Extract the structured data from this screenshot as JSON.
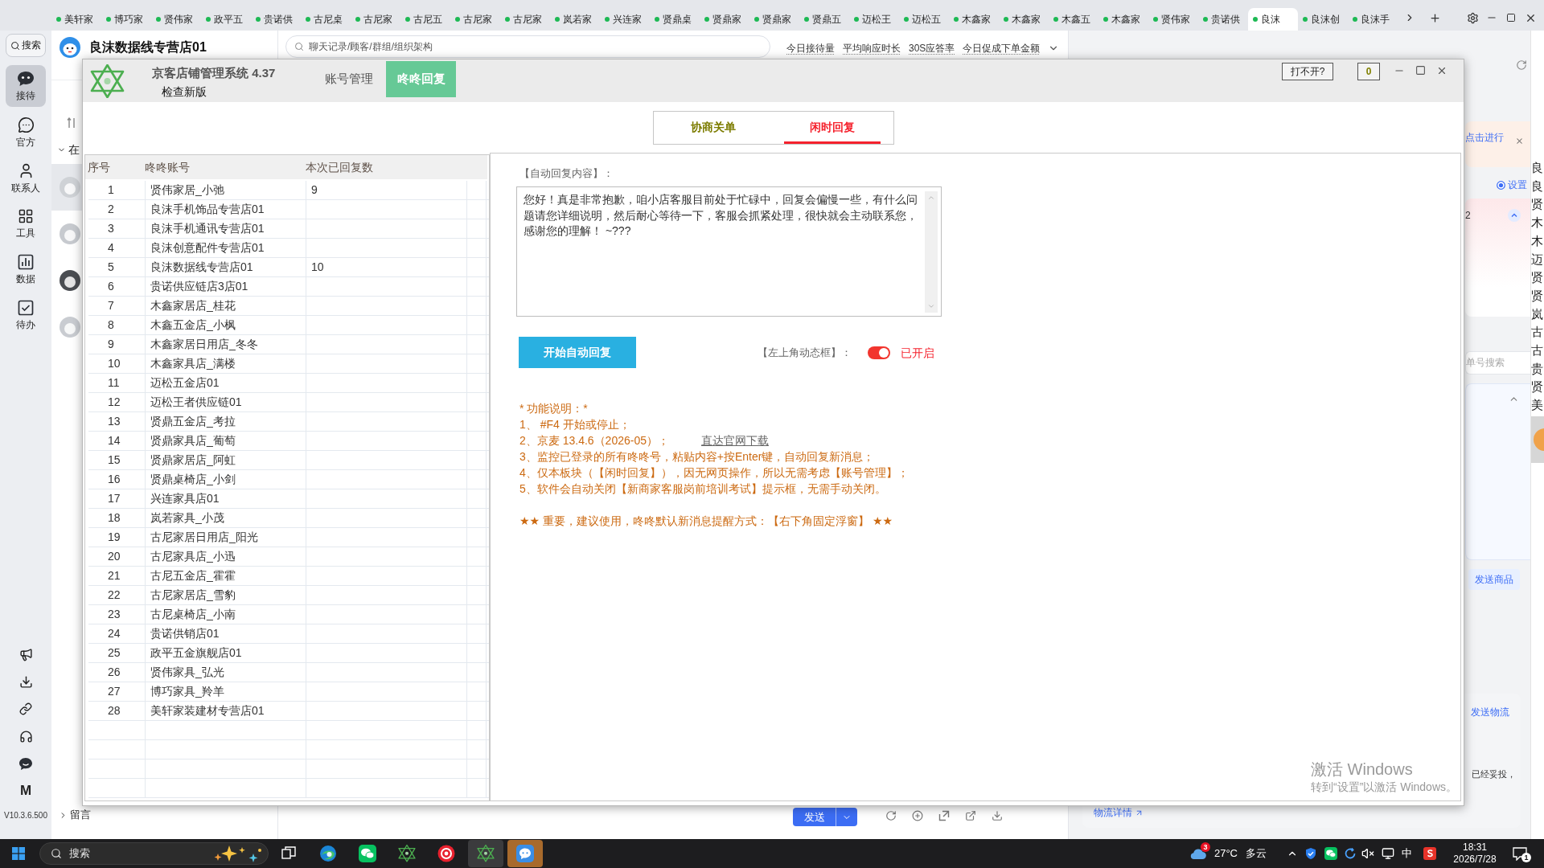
{
  "top_bar": {
    "tabs": [
      {
        "label": "美轩家",
        "selected": false
      },
      {
        "label": "博巧家",
        "selected": false
      },
      {
        "label": "贤伟家",
        "selected": false
      },
      {
        "label": "政平五",
        "selected": false
      },
      {
        "label": "贵诺供",
        "selected": false
      },
      {
        "label": "古尼桌",
        "selected": false
      },
      {
        "label": "古尼家",
        "selected": false
      },
      {
        "label": "古尼五",
        "selected": false
      },
      {
        "label": "古尼家",
        "selected": false
      },
      {
        "label": "古尼家",
        "selected": false
      },
      {
        "label": "岚若家",
        "selected": false
      },
      {
        "label": "兴连家",
        "selected": false
      },
      {
        "label": "贤鼎桌",
        "selected": false
      },
      {
        "label": "贤鼎家",
        "selected": false
      },
      {
        "label": "贤鼎家",
        "selected": false
      },
      {
        "label": "贤鼎五",
        "selected": false
      },
      {
        "label": "迈松王",
        "selected": false
      },
      {
        "label": "迈松五",
        "selected": false
      },
      {
        "label": "木鑫家",
        "selected": false
      },
      {
        "label": "木鑫家",
        "selected": false
      },
      {
        "label": "木鑫五",
        "selected": false
      },
      {
        "label": "木鑫家",
        "selected": false
      },
      {
        "label": "贤伟家",
        "selected": false
      },
      {
        "label": "贵诺供",
        "selected": false
      },
      {
        "label": "良沫",
        "selected": true
      },
      {
        "label": "良沫创",
        "selected": false
      },
      {
        "label": "良沫手",
        "selected": false
      }
    ]
  },
  "sidebar": {
    "search_label": "搜索",
    "items": [
      {
        "label": "接待",
        "selected": true
      },
      {
        "label": "官方",
        "selected": false
      },
      {
        "label": "联系人",
        "selected": false
      },
      {
        "label": "工具",
        "selected": false
      },
      {
        "label": "数据",
        "selected": false
      },
      {
        "label": "待办",
        "selected": false
      }
    ],
    "bottom_mark": "M",
    "version": "V10.3.6.500"
  },
  "conversations": {
    "store_name": "良沫数据线专营店01",
    "group": {
      "label": "在",
      "expanded": true
    },
    "rows": [
      {
        "selected": true
      },
      {
        "selected": false
      },
      {
        "selected": false
      },
      {
        "selected": false
      }
    ],
    "footer_group": {
      "label": "留言",
      "expanded": false
    }
  },
  "chat": {
    "search_placeholder": "聊天记录/顾客/群组/组织架构",
    "stats": [
      "今日接待量",
      "平均响应时长",
      "30S应答率",
      "今日促成下单金额"
    ],
    "send_label": "发送"
  },
  "side_panel": {
    "notice": "点击进行",
    "settings_option": {
      "label": "设置",
      "selected": true
    },
    "card_value": "2",
    "search_placeholder": "单号搜索",
    "send_product": "发送商品",
    "send_logistics": "发送物流",
    "delivery_status": "已经妥投，",
    "logistics_link": "物流详情"
  },
  "edge_list": [
    "良",
    "良",
    "贤",
    "木",
    "木",
    "迈",
    "贤",
    "贤",
    "岚",
    "古",
    "古",
    "贵",
    "贤",
    "美"
  ],
  "tool_window": {
    "title": "京客店铺管理系统 4.37",
    "update_link": "检查新版",
    "nav": [
      {
        "label": "账号管理",
        "selected": false
      },
      {
        "label": "咚咚回复",
        "selected": true
      }
    ],
    "help_button": "打不开?",
    "counter": "0",
    "sub_tabs": [
      {
        "label": "协商关单",
        "selected": false
      },
      {
        "label": "闲时回复",
        "selected": true
      }
    ],
    "table": {
      "columns": [
        "序号",
        "咚咚账号",
        "本次已回复数"
      ],
      "rows": [
        {
          "index": "1",
          "account": "贤伟家居_小弛",
          "replies": "9"
        },
        {
          "index": "2",
          "account": "良沫手机饰品专营店01"
        },
        {
          "index": "3",
          "account": "良沫手机通讯专营店01"
        },
        {
          "index": "4",
          "account": "良沫创意配件专营店01"
        },
        {
          "index": "5",
          "account": "良沫数据线专营店01",
          "replies": "10"
        },
        {
          "index": "6",
          "account": "贵诺供应链店3店01"
        },
        {
          "index": "7",
          "account": "木鑫家居店_桂花"
        },
        {
          "index": "8",
          "account": "木鑫五金店_小枫"
        },
        {
          "index": "9",
          "account": "木鑫家居日用店_冬冬"
        },
        {
          "index": "10",
          "account": "木鑫家具店_满楼"
        },
        {
          "index": "11",
          "account": "迈松五金店01"
        },
        {
          "index": "12",
          "account": "迈松王者供应链01"
        },
        {
          "index": "13",
          "account": "贤鼎五金店_考拉"
        },
        {
          "index": "14",
          "account": "贤鼎家具店_葡萄"
        },
        {
          "index": "15",
          "account": "贤鼎家居店_阿虹"
        },
        {
          "index": "16",
          "account": "贤鼎桌椅店_小剑"
        },
        {
          "index": "17",
          "account": "兴连家具店01"
        },
        {
          "index": "18",
          "account": "岚若家具_小茂"
        },
        {
          "index": "19",
          "account": "古尼家居日用店_阳光"
        },
        {
          "index": "20",
          "account": "古尼家具店_小迅"
        },
        {
          "index": "21",
          "account": "古尼五金店_霍霍"
        },
        {
          "index": "22",
          "account": "古尼家居店_雪豹"
        },
        {
          "index": "23",
          "account": "古尼桌椅店_小南"
        },
        {
          "index": "24",
          "account": "贵诺供销店01"
        },
        {
          "index": "25",
          "account": "政平五金旗舰店01"
        },
        {
          "index": "26",
          "account": "贤伟家具_弘光"
        },
        {
          "index": "27",
          "account": "博巧家具_羚羊"
        },
        {
          "index": "28",
          "account": "美轩家装建材专营店01"
        }
      ]
    },
    "reply_label": "【自动回复内容】：",
    "reply_text": "您好！真是非常抱歉，咱小店客服目前处于忙碌中，回复会偏慢一些，有什么问题请您详细说明，然后耐心等待一下，客服会抓紧处理，很快就会主动联系您，感谢您的理解！ ~???",
    "start_button": "开始自动回复",
    "toggle": {
      "label": "【左上角动态框】：",
      "on": true,
      "status": "已开启"
    },
    "notes": [
      "* 功能说明：*",
      "1、 #F4 开始或停止；",
      "2、京麦 13.4.6（2026-05）；",
      "3、监控已登录的所有咚咚号，粘贴内容+按Enter键，自动回复新消息；",
      "4、仅本板块（【闲时回复】），因无网页操作，所以无需考虑【账号管理】；",
      "5、软件会自动关闭【新商家客服岗前培训考试】提示框，无需手动关闭。"
    ],
    "download_link": "直达官网下载",
    "important": "★★ 重要，建议使用，咚咚默认新消息提醒方式：【右下角固定浮窗】 ★★"
  },
  "activation_notice": {
    "title": "激活 Windows",
    "hint": "转到“设置”以激活 Windows。"
  },
  "taskbar": {
    "search_placeholder": "搜索",
    "apps": [
      {
        "kind": "task-view",
        "active": false,
        "flashing": false
      },
      {
        "kind": "browser",
        "active": false,
        "flashing": false
      },
      {
        "kind": "messenger",
        "active": false,
        "flashing": false
      },
      {
        "kind": "star-app",
        "active": false,
        "flashing": false
      },
      {
        "kind": "recorder",
        "active": false,
        "flashing": false
      },
      {
        "kind": "star-app",
        "active": true,
        "flashing": false
      },
      {
        "kind": "chat-app",
        "active": false,
        "flashing": true
      }
    ],
    "weather": {
      "badge": "3",
      "temperature": "27°C",
      "condition": "多云"
    },
    "ime": "中",
    "time": "18:31",
    "date": "2026/7/28",
    "notification_badge": "1"
  }
}
